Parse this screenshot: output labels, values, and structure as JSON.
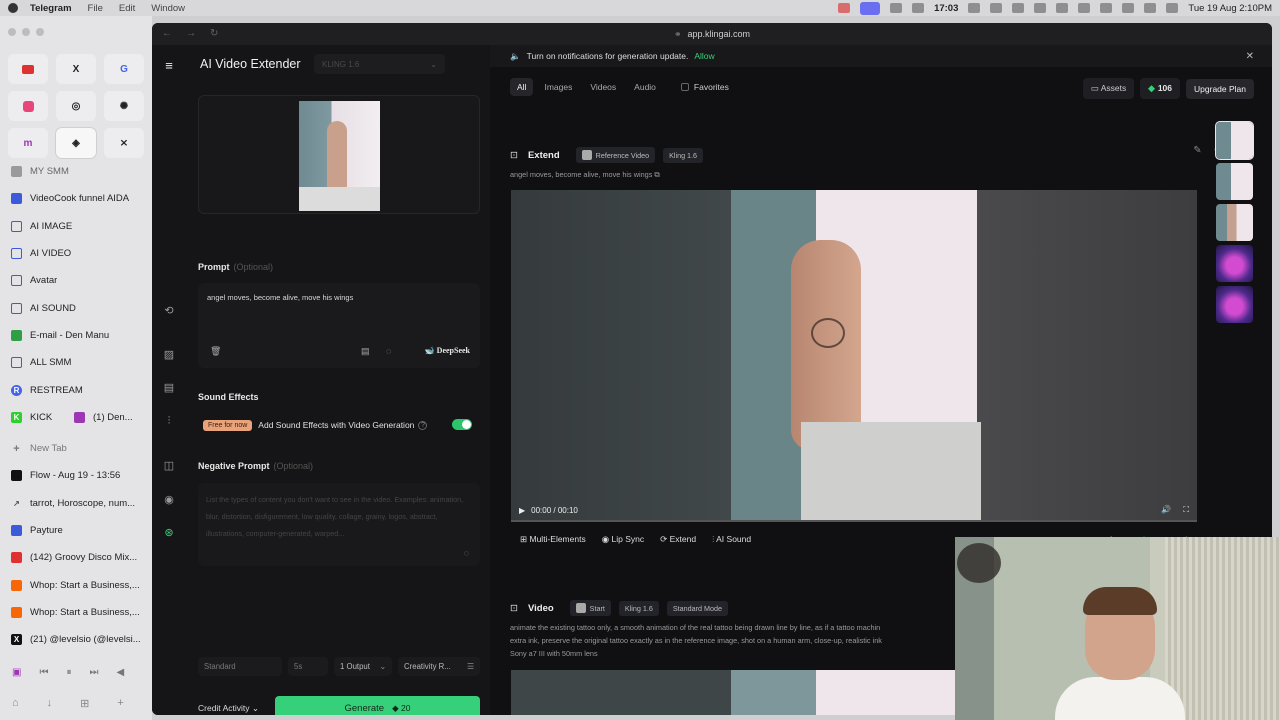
{
  "menubar": {
    "app": "Telegram",
    "items": [
      "File",
      "Edit",
      "Window"
    ],
    "clock": "17:03",
    "datetime": "Tue 19 Aug  2:10PM"
  },
  "sidebar": {
    "tabs": [
      {
        "label": "MY SMM",
        "color": "#888888"
      },
      {
        "label": "VideoCook funnel AIDA",
        "color": "#3b5bdb"
      },
      {
        "label": "AI IMAGE",
        "color": "#3b5bdb"
      },
      {
        "label": "AI VIDEO",
        "color": "#3b5bdb"
      },
      {
        "label": "Avatar",
        "color": "#3b5bdb"
      },
      {
        "label": "AI SOUND",
        "color": "#3b5bdb"
      },
      {
        "label": "E-mail - Den Manu",
        "color": "#2f9e44"
      },
      {
        "label": "ALL SMM",
        "color": "#3b5bdb"
      },
      {
        "label": "RESTREAM",
        "color": "#4263eb"
      },
      {
        "label": "KICK",
        "color": "#2fcf2f",
        "extra": "(1) Den..."
      }
    ],
    "new_tab": "New Tab",
    "recent": [
      {
        "label": "Flow - Aug 19 - 13:56",
        "color": "#111111"
      },
      {
        "label": "tarrot, Horoscope, num...",
        "color": "#e0a040"
      },
      {
        "label": "Payture",
        "color": "#3b5bdb"
      },
      {
        "label": "(142) Groovy Disco Mix...",
        "color": "#e03131"
      },
      {
        "label": "Whop: Start a Business,...",
        "color": "#f76707"
      },
      {
        "label": "Whop: Start a Business,...",
        "color": "#f76707"
      },
      {
        "label": "(21) @levelsio (@levelsi...",
        "color": "#111111"
      }
    ]
  },
  "browser": {
    "url": "app.klingai.com"
  },
  "panel": {
    "title": "AI Video Extender",
    "model": "KLING 1.6",
    "prompt_label": "Prompt",
    "optional": "(Optional)",
    "prompt_text": "angel moves, become alive, move his wings",
    "deepseek": "DeepSeek",
    "sound_label": "Sound Effects",
    "free_badge": "Free for now",
    "sound_text": "Add Sound Effects with Video Generation",
    "sound_enabled": true,
    "neg_label": "Negative Prompt",
    "neg_placeholder": "List the types of content you don't want to see in the video. Examples: animation, blur, distortion, disfigurement, low quality, collage, grainy, logos, abstract, illustrations, computer-generated, warped...",
    "mode": "Standard",
    "duration": "5s",
    "outputs": "1 Output",
    "creativity": "Creativity R...",
    "credit_activity": "Credit Activity",
    "generate": "Generate",
    "generate_cost": "20"
  },
  "content": {
    "notification": "Turn on notifications for generation update.",
    "allow": "Allow",
    "filters": [
      "All",
      "Images",
      "Videos",
      "Audio"
    ],
    "favorites": "Favorites",
    "assets": "Assets",
    "credits": "106",
    "upgrade": "Upgrade Plan",
    "card1": {
      "title": "Extend",
      "chip_ref": "Reference Video",
      "chip_model": "Kling 1.6",
      "prompt": "angel moves, become alive, move his wings",
      "time": "00:00 / 00:10",
      "progress": 0.0,
      "actions": [
        "Multi-Elements",
        "Lip Sync",
        "Extend",
        "AI Sound"
      ]
    },
    "card2": {
      "title": "Video",
      "chip_start": "Start",
      "chip_model": "Kling 1.6",
      "chip_mode": "Standard Mode",
      "prompt_l1": "animate the existing tattoo only, a smooth animation of the real tattoo being drawn line by line, as if a tattoo machin",
      "prompt_l2": "extra ink, preserve the original tattoo exactly as in the reference image, shot on a human arm, close-up, realistic ink",
      "prompt_l3": "Sony a7 III with 50mm lens"
    }
  }
}
